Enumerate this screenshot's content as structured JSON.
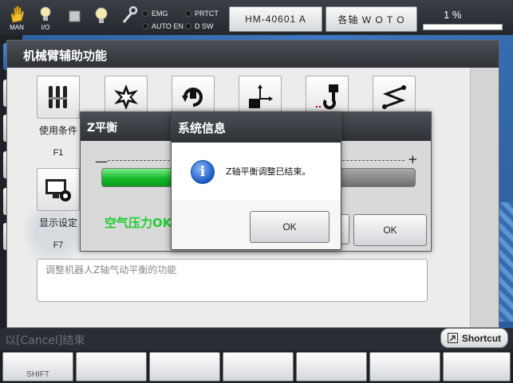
{
  "status_bar": {
    "mode_label": "MAN",
    "io_label": "I/O",
    "indicators": [
      "EMG",
      "PRTCT",
      "AUTO EN",
      "D SW"
    ],
    "model_label": "HM-40601 A",
    "axis_label": "各轴  W O T O",
    "override_value": "1 %"
  },
  "main_window": {
    "title": "机械臂辅助功能",
    "functions": [
      {
        "name": "使用条件",
        "key": "F1",
        "icon": "tools-icon"
      },
      {
        "name": "",
        "key": "",
        "icon": "explosion-icon"
      },
      {
        "name": "",
        "key": "",
        "icon": "rotate-arm-icon"
      },
      {
        "name": "",
        "key": "",
        "icon": "axis-arrow-icon"
      },
      {
        "name": "",
        "key": "",
        "icon": "hook-icon"
      },
      {
        "name": "",
        "key": "",
        "icon": "path-icon"
      },
      {
        "name": "显示设定",
        "key": "F7",
        "icon": "monitor-gear-icon"
      }
    ],
    "description": "调整机器人Z轴气动平衡的功能"
  },
  "z_balance_dialog": {
    "title": "Z平衡",
    "minus": "—",
    "plus": "+",
    "progress": 0.22,
    "air_pressure_label": "空气压力OK",
    "ok_label": "OK"
  },
  "system_dialog": {
    "title": "系统信息",
    "message": "Z轴平衡调整已结束。",
    "ok_label": "OK",
    "icon": "info-icon"
  },
  "bottom": {
    "hint": "以[Cancel]结束",
    "shortcut_label": "Shortcut",
    "fkeys": [
      "SHIFT",
      "",
      "",
      "",
      "",
      "",
      ""
    ]
  }
}
